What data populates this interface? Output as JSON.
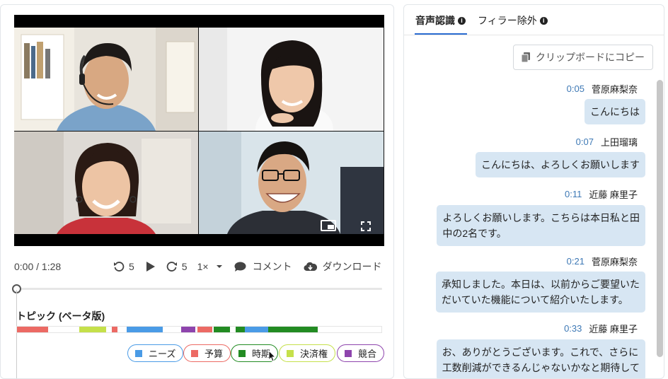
{
  "player": {
    "time_display": "0:00 / 1:28",
    "rewind_seconds": "5",
    "forward_seconds": "5",
    "speed": "1×",
    "comment_label": "コメント",
    "download_label": "ダウンロード",
    "progress_fraction": 0.0
  },
  "topics": {
    "title": "トピック (ベータ版)",
    "segments": [
      {
        "topic": "予算",
        "start": 0.0,
        "end": 0.085
      },
      {
        "topic": "決済権",
        "start": 0.17,
        "end": 0.245
      },
      {
        "topic": "予算",
        "start": 0.26,
        "end": 0.275
      },
      {
        "topic": "ニーズ",
        "start": 0.3,
        "end": 0.4
      },
      {
        "topic": "競合",
        "start": 0.45,
        "end": 0.49
      },
      {
        "topic": "予算",
        "start": 0.495,
        "end": 0.535
      },
      {
        "topic": "時期",
        "start": 0.54,
        "end": 0.585
      },
      {
        "topic": "時期",
        "start": 0.6,
        "end": 0.625
      },
      {
        "topic": "ニーズ",
        "start": 0.625,
        "end": 0.69
      },
      {
        "topic": "時期",
        "start": 0.69,
        "end": 0.825
      }
    ],
    "legend": [
      {
        "label": "ニーズ",
        "color": "#4a9be6",
        "border": "#4a9be6"
      },
      {
        "label": "予算",
        "color": "#ec6a64",
        "border": "#ec6a64"
      },
      {
        "label": "時期",
        "color": "#228b22",
        "border": "#228b22"
      },
      {
        "label": "決済権",
        "color": "#c5e04a",
        "border": "#c5e04a"
      },
      {
        "label": "競合",
        "color": "#8e44ad",
        "border": "#8e44ad"
      }
    ]
  },
  "transcript": {
    "tabs": [
      {
        "label": "音声認識",
        "active": true
      },
      {
        "label": "フィラー除外",
        "active": false
      }
    ],
    "copy_button": "クリップボードにコピー",
    "messages": [
      {
        "time": "0:05",
        "speaker": "菅原麻梨奈",
        "lines": [
          "こんにちは"
        ]
      },
      {
        "time": "0:07",
        "speaker": "上田瑠璃",
        "lines": [
          "こんにちは、よろしくお願いします"
        ]
      },
      {
        "time": "0:11",
        "speaker": "近藤 麻里子",
        "lines": [
          "よろしくお願いします。こちらは本日私と田",
          "中の2名です。"
        ]
      },
      {
        "time": "0:21",
        "speaker": "菅原麻梨奈",
        "lines": [
          "承知しました。本日は、以前からご要望いた",
          "だいていた機能について紹介いたします。"
        ]
      },
      {
        "time": "0:33",
        "speaker": "近藤 麻里子",
        "lines": [
          "お、ありがとうございます。これで、さらに",
          "工数削減ができるんじゃないかなと期待して"
        ]
      }
    ]
  }
}
